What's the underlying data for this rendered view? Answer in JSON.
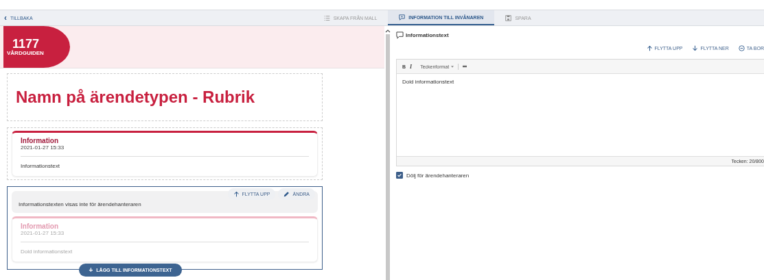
{
  "toolbar": {
    "back": {
      "icon": "‹",
      "label": "TILLBAKA"
    },
    "tabs": [
      {
        "label": "SKAPA FRÅN MALL",
        "kind": "list",
        "selected": false
      },
      {
        "label": "INFORMATION TILL INVÅNAREN",
        "kind": "message",
        "selected": true
      },
      {
        "label": "SPARA",
        "kind": "save",
        "selected": false
      }
    ]
  },
  "logo": {
    "number": "1177",
    "name": "VÅRDGUIDEN"
  },
  "title": "Namn på ärendetypen - Rubrik",
  "blocks": [
    {
      "selected": false,
      "hidden": false,
      "heading": "Information",
      "date": "2021-01-27 15:33",
      "body": "Informationstext"
    },
    {
      "selected": true,
      "hidden": true,
      "notice": "Informationstexten visas inte för ärendehanteraren",
      "actions": [
        {
          "kind": "up",
          "label": "FLYTTA UPP"
        },
        {
          "kind": "edit",
          "label": "ÄNDRA"
        }
      ],
      "heading": "Information",
      "date": "2021-01-27 15:33",
      "body": "Dold informationstext"
    }
  ],
  "add_button": {
    "icon": "+",
    "label": "LÄGG TILL INFORMATIONSTEXT"
  },
  "editor_panel": {
    "heading": "Informationstext",
    "actions": [
      {
        "kind": "up",
        "label": "FLYTTA UPP"
      },
      {
        "kind": "down",
        "label": "FLYTTA NER"
      },
      {
        "kind": "remove",
        "label": "TA BOR"
      }
    ],
    "format_buttons": [
      {
        "kind": "bold",
        "label": "B"
      },
      {
        "kind": "italic",
        "label": "I"
      }
    ],
    "format_menu": "Teckenformat",
    "text": "Dold informationstext",
    "counter": "Tecken: 20/800",
    "hide_checkbox": {
      "label": "Dölj för ärendehanteraren",
      "checked": true
    }
  }
}
